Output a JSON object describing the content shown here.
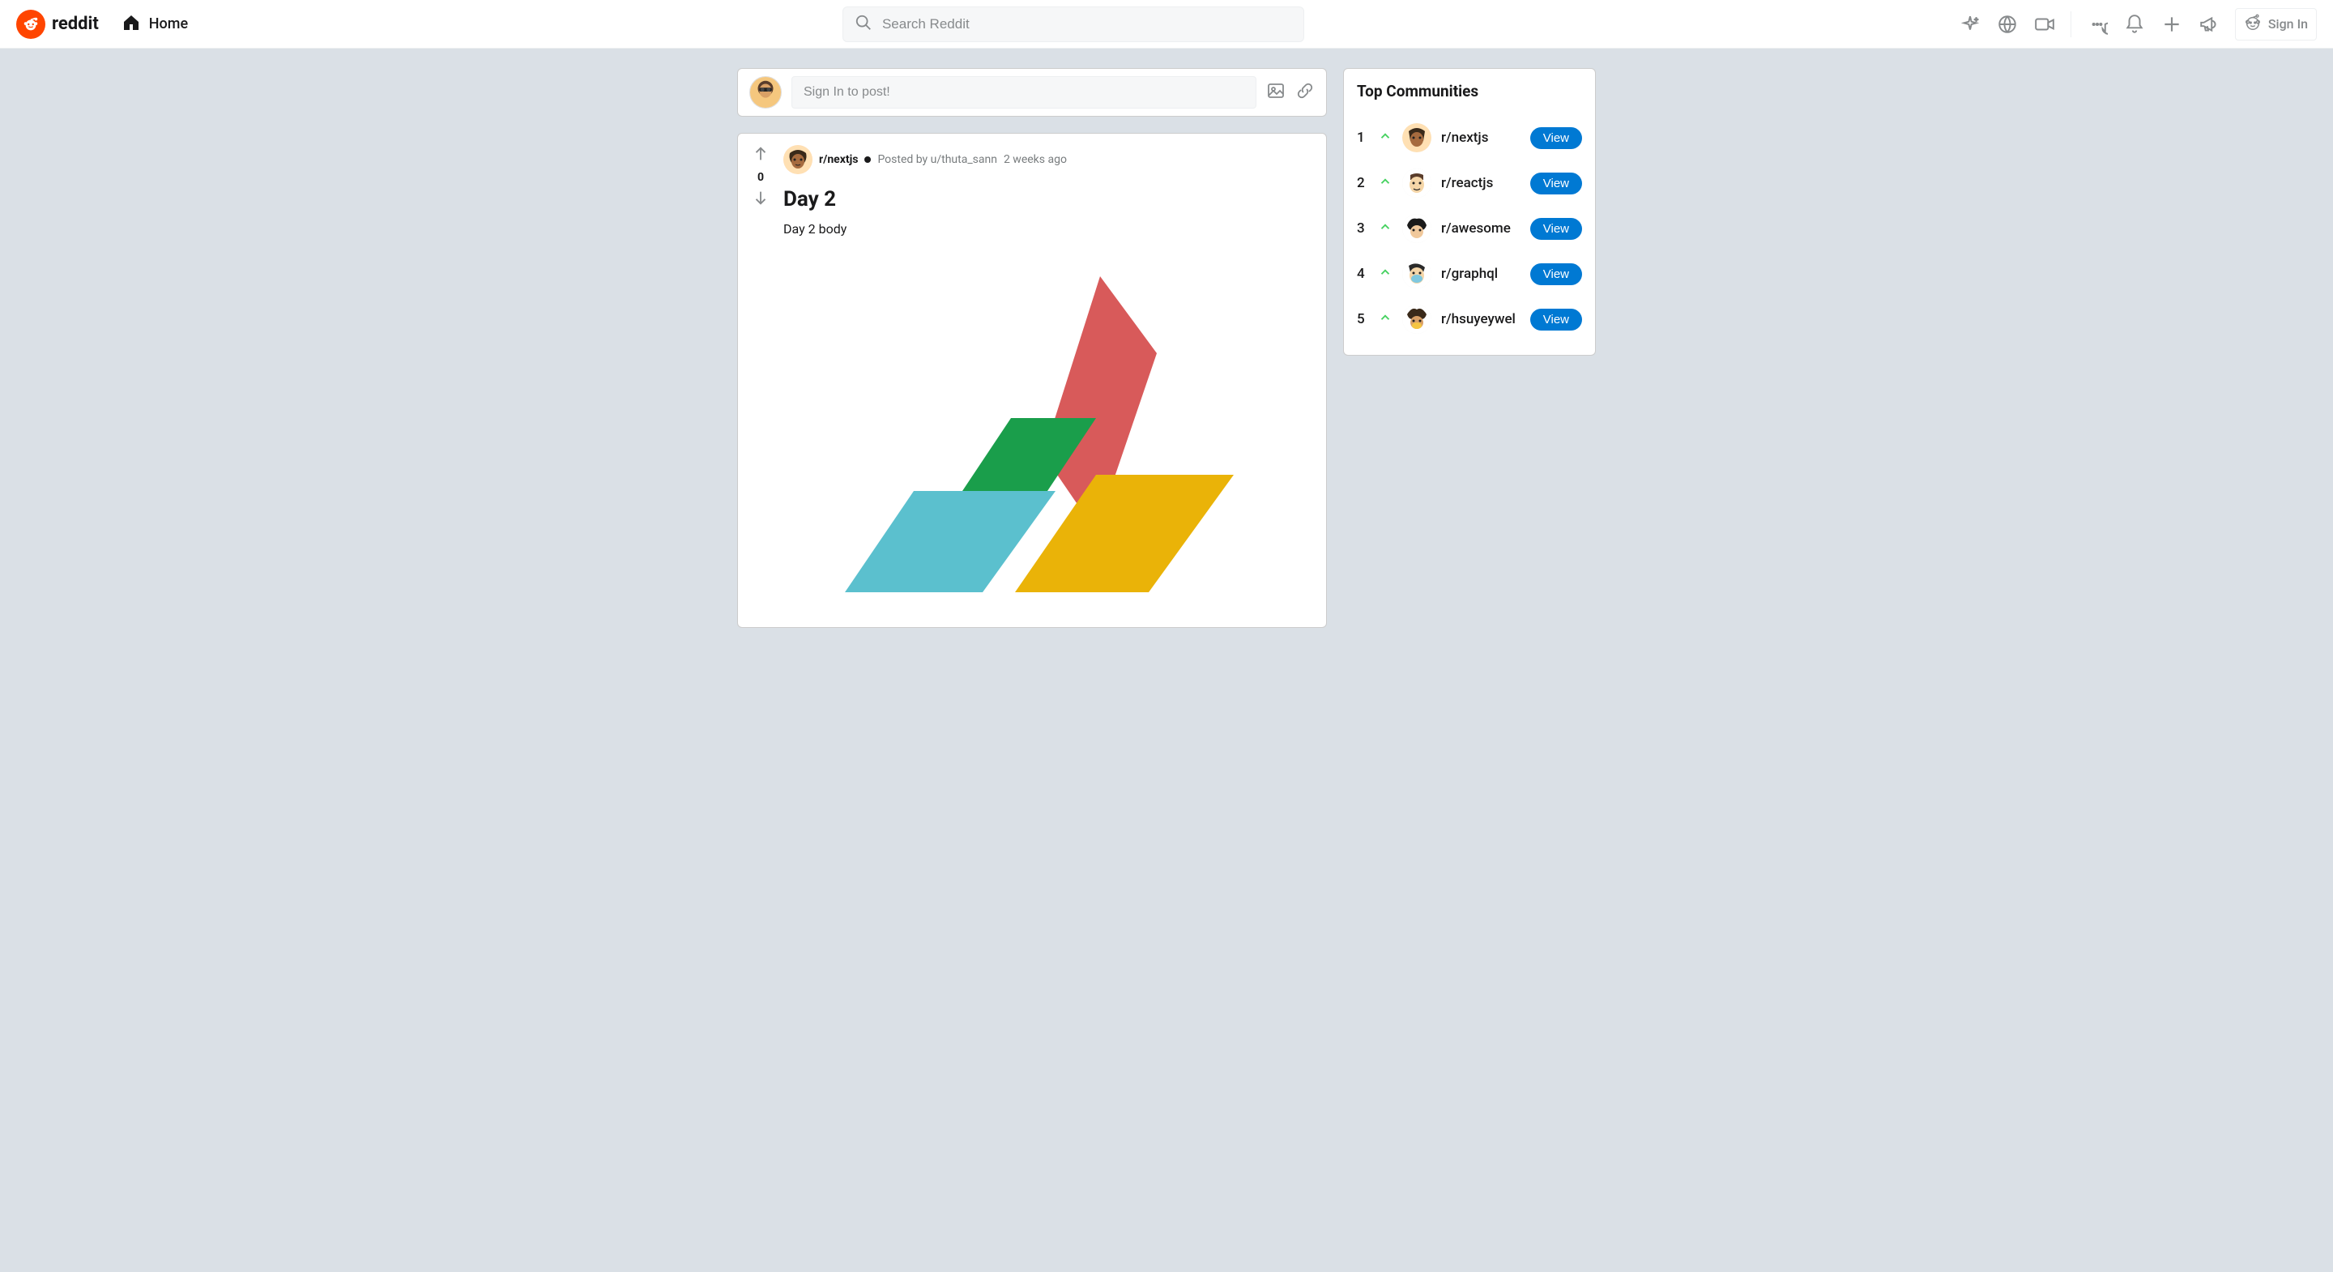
{
  "header": {
    "brand": "reddit",
    "home_label": "Home",
    "search_placeholder": "Search Reddit",
    "signin_label": "Sign In"
  },
  "create_bar": {
    "placeholder": "Sign In to post!"
  },
  "post": {
    "vote_count": "0",
    "subreddit": "r/nextjs",
    "posted_by": "Posted by u/thuta_sann",
    "time": "2 weeks ago",
    "title": "Day 2",
    "body": "Day 2 body"
  },
  "sidebar": {
    "title": "Top Communities",
    "view_label": "View",
    "items": [
      {
        "rank": "1",
        "name": "r/nextjs"
      },
      {
        "rank": "2",
        "name": "r/reactjs"
      },
      {
        "rank": "3",
        "name": "r/awesome"
      },
      {
        "rank": "4",
        "name": "r/graphql"
      },
      {
        "rank": "5",
        "name": "r/hsuyeywel"
      }
    ]
  }
}
